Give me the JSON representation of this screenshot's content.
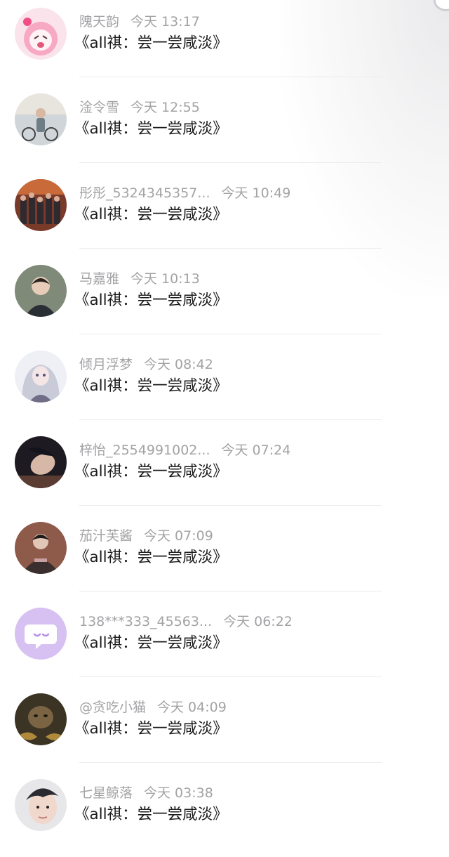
{
  "comments": [
    {
      "username": "隗天韵",
      "time": "今天 13:17",
      "message": "《all祺：尝一尝咸淡》",
      "avatar": {
        "icon": "anime-girl-avatar",
        "colors": [
          "#fbe3ec",
          "#f7a9c4",
          "#fff3f6"
        ]
      }
    },
    {
      "username": "淦令雪",
      "time": "今天 12:55",
      "message": "《all祺：尝一尝咸淡》",
      "avatar": {
        "icon": "person-bicycle-avatar",
        "colors": [
          "#cfd5d8",
          "#6f7d86",
          "#e8e4de"
        ]
      }
    },
    {
      "username": "彤彤_5324345357...",
      "time": "今天 10:49",
      "message": "《all祺：尝一尝咸淡》",
      "avatar": {
        "icon": "group-photo-avatar",
        "colors": [
          "#7a3a2a",
          "#c96a3a",
          "#2e2a30"
        ]
      }
    },
    {
      "username": "马嘉雅",
      "time": "今天 10:13",
      "message": "《all祺：尝一尝咸淡》",
      "avatar": {
        "icon": "boy-portrait-avatar",
        "colors": [
          "#7f8b78",
          "#2a2f36",
          "#e7cdb9"
        ]
      }
    },
    {
      "username": "倾月浮梦",
      "time": "今天 08:42",
      "message": "《all祺：尝一尝咸淡》",
      "avatar": {
        "icon": "anime-silver-hair-avatar",
        "colors": [
          "#c9ccd8",
          "#6f6e86",
          "#eef0f6"
        ]
      }
    },
    {
      "username": "梓怡_2554991002...",
      "time": "今天 07:24",
      "message": "《all祺：尝一尝咸淡》",
      "avatar": {
        "icon": "lying-boy-avatar",
        "colors": [
          "#1d1a22",
          "#5a3c33",
          "#d7b8a6"
        ]
      }
    },
    {
      "username": "茄汁芙酱",
      "time": "今天 07:09",
      "message": "《all祺：尝一尝咸淡》",
      "avatar": {
        "icon": "hoodie-boy-avatar",
        "colors": [
          "#3a2f2e",
          "#8e5a4a",
          "#e2c6b6"
        ]
      }
    },
    {
      "username": "138***333_45563...",
      "time": "今天 06:22",
      "message": "《all祺：尝一尝咸淡》",
      "avatar": {
        "icon": "chat-bubble-avatar",
        "colors": [
          "#d7c1f2",
          "#ffffff",
          "#b690e4"
        ]
      }
    },
    {
      "username": "@贪吃小猫",
      "time": "今天 04:09",
      "message": "《all祺：尝一尝咸淡》",
      "avatar": {
        "icon": "blurry-cat-avatar",
        "colors": [
          "#3b3324",
          "#b08a3a",
          "#7a6444"
        ]
      }
    },
    {
      "username": "七星鲸落",
      "time": "今天 03:38",
      "message": "《all祺：尝一尝咸淡》",
      "avatar": {
        "icon": "boy-closeup-avatar",
        "colors": [
          "#e7e6e8",
          "#2a2a30",
          "#f0d8cc"
        ]
      }
    }
  ]
}
